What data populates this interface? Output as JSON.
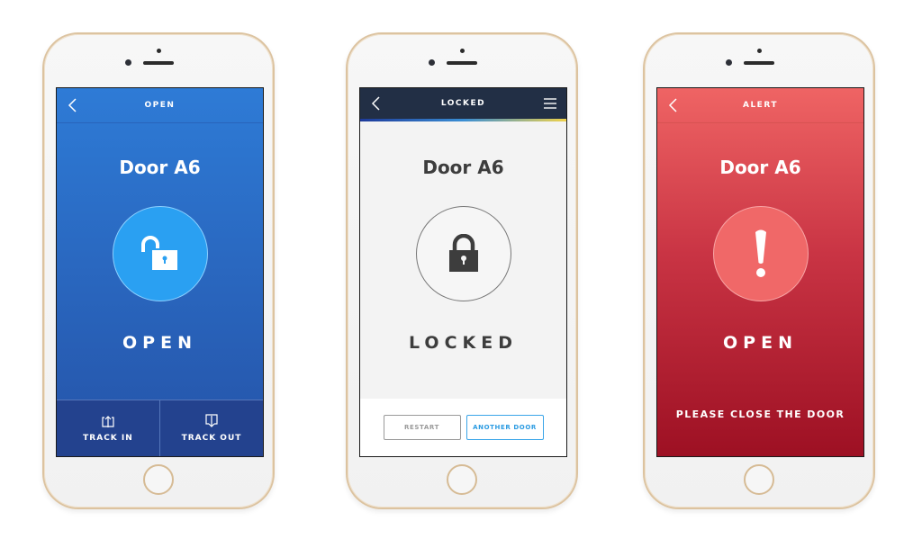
{
  "screens": [
    {
      "header_title": "OPEN",
      "door_name": "Door A6",
      "status": "OPEN",
      "icon": "unlocked-padlock-icon",
      "colors": {
        "background_top": "#2e7bd6",
        "background_bottom": "#2553a8",
        "circle": "#2aa0f2"
      },
      "actions": [
        {
          "label": "TRACK IN",
          "icon": "track-in-icon"
        },
        {
          "label": "TRACK OUT",
          "icon": "track-out-icon"
        }
      ]
    },
    {
      "header_title": "LOCKED",
      "door_name": "Door A6",
      "status": "LOCKED",
      "icon": "locked-padlock-icon",
      "colors": {
        "header": "#222f45",
        "background": "#f3f3f3",
        "accent": "#2b9be2"
      },
      "buttons": [
        {
          "label": "RESTART"
        },
        {
          "label": "ANOTHER DOOR"
        }
      ]
    },
    {
      "header_title": "ALERT",
      "door_name": "Door A6",
      "status": "OPEN",
      "icon": "exclamation-icon",
      "message": "PLEASE CLOSE THE DOOR",
      "colors": {
        "background_top": "#ef6464",
        "background_bottom": "#9d1023",
        "circle": "#f06868"
      }
    }
  ]
}
